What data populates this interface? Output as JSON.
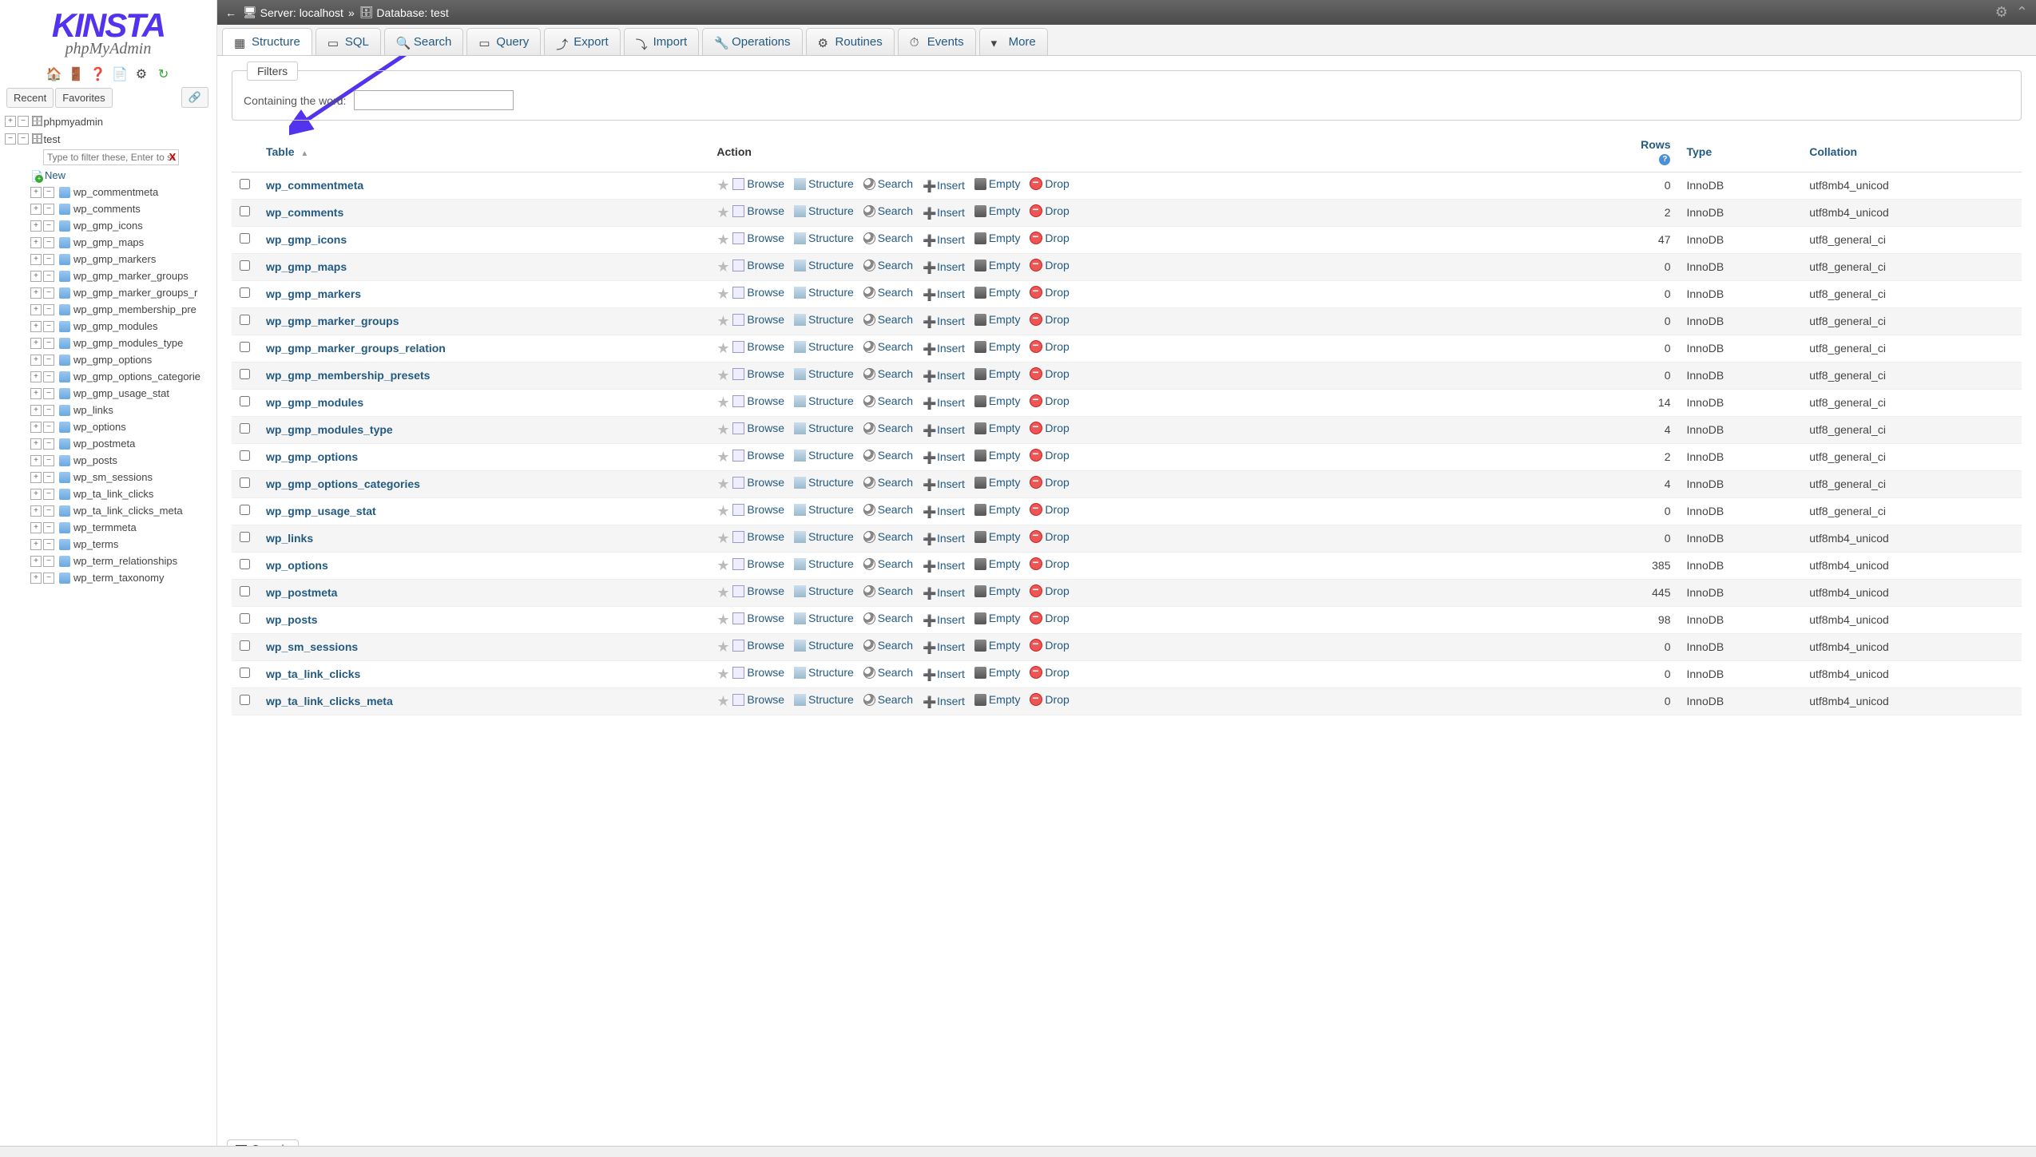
{
  "brand": {
    "name": "KINSTA",
    "subtitle": "phpMyAdmin"
  },
  "nav_icons": [
    "home-icon",
    "exit-icon",
    "help-icon",
    "sql-icon",
    "gear-icon",
    "reload-icon"
  ],
  "recent_fav": {
    "recent": "Recent",
    "favorites": "Favorites"
  },
  "tree": {
    "root": "phpmyadmin",
    "db": "test",
    "filter_placeholder": "Type to filter these, Enter to search",
    "new_label": "New",
    "tables": [
      "wp_commentmeta",
      "wp_comments",
      "wp_gmp_icons",
      "wp_gmp_maps",
      "wp_gmp_markers",
      "wp_gmp_marker_groups",
      "wp_gmp_marker_groups_r",
      "wp_gmp_membership_pre",
      "wp_gmp_modules",
      "wp_gmp_modules_type",
      "wp_gmp_options",
      "wp_gmp_options_categorie",
      "wp_gmp_usage_stat",
      "wp_links",
      "wp_options",
      "wp_postmeta",
      "wp_posts",
      "wp_sm_sessions",
      "wp_ta_link_clicks",
      "wp_ta_link_clicks_meta",
      "wp_termmeta",
      "wp_terms",
      "wp_term_relationships",
      "wp_term_taxonomy"
    ]
  },
  "breadcrumb": {
    "server_label": "Server:",
    "server": "localhost",
    "db_label": "Database:",
    "db": "test"
  },
  "tabs": [
    {
      "icon": "structure-icon",
      "label": "Structure",
      "active": true
    },
    {
      "icon": "sql-icon",
      "label": "SQL"
    },
    {
      "icon": "search-icon",
      "label": "Search"
    },
    {
      "icon": "query-icon",
      "label": "Query"
    },
    {
      "icon": "export-icon",
      "label": "Export"
    },
    {
      "icon": "import-icon",
      "label": "Import"
    },
    {
      "icon": "operations-icon",
      "label": "Operations"
    },
    {
      "icon": "routines-icon",
      "label": "Routines"
    },
    {
      "icon": "events-icon",
      "label": "Events"
    },
    {
      "icon": "more-icon",
      "label": "More"
    }
  ],
  "filters": {
    "legend": "Filters",
    "label": "Containing the word:",
    "value": ""
  },
  "columns": {
    "table": "Table",
    "action": "Action",
    "rows": "Rows",
    "type": "Type",
    "collation": "Collation"
  },
  "actions": {
    "browse": "Browse",
    "structure": "Structure",
    "search": "Search",
    "insert": "Insert",
    "empty": "Empty",
    "drop": "Drop"
  },
  "rows": [
    {
      "name": "wp_commentmeta",
      "rows": "0",
      "type": "InnoDB",
      "collation": "utf8mb4_unicod"
    },
    {
      "name": "wp_comments",
      "rows": "2",
      "type": "InnoDB",
      "collation": "utf8mb4_unicod"
    },
    {
      "name": "wp_gmp_icons",
      "rows": "47",
      "type": "InnoDB",
      "collation": "utf8_general_ci"
    },
    {
      "name": "wp_gmp_maps",
      "rows": "0",
      "type": "InnoDB",
      "collation": "utf8_general_ci"
    },
    {
      "name": "wp_gmp_markers",
      "rows": "0",
      "type": "InnoDB",
      "collation": "utf8_general_ci"
    },
    {
      "name": "wp_gmp_marker_groups",
      "rows": "0",
      "type": "InnoDB",
      "collation": "utf8_general_ci"
    },
    {
      "name": "wp_gmp_marker_groups_relation",
      "rows": "0",
      "type": "InnoDB",
      "collation": "utf8_general_ci"
    },
    {
      "name": "wp_gmp_membership_presets",
      "rows": "0",
      "type": "InnoDB",
      "collation": "utf8_general_ci"
    },
    {
      "name": "wp_gmp_modules",
      "rows": "14",
      "type": "InnoDB",
      "collation": "utf8_general_ci"
    },
    {
      "name": "wp_gmp_modules_type",
      "rows": "4",
      "type": "InnoDB",
      "collation": "utf8_general_ci"
    },
    {
      "name": "wp_gmp_options",
      "rows": "2",
      "type": "InnoDB",
      "collation": "utf8_general_ci"
    },
    {
      "name": "wp_gmp_options_categories",
      "rows": "4",
      "type": "InnoDB",
      "collation": "utf8_general_ci"
    },
    {
      "name": "wp_gmp_usage_stat",
      "rows": "0",
      "type": "InnoDB",
      "collation": "utf8_general_ci"
    },
    {
      "name": "wp_links",
      "rows": "0",
      "type": "InnoDB",
      "collation": "utf8mb4_unicod"
    },
    {
      "name": "wp_options",
      "rows": "385",
      "type": "InnoDB",
      "collation": "utf8mb4_unicod"
    },
    {
      "name": "wp_postmeta",
      "rows": "445",
      "type": "InnoDB",
      "collation": "utf8mb4_unicod"
    },
    {
      "name": "wp_posts",
      "rows": "98",
      "type": "InnoDB",
      "collation": "utf8mb4_unicod"
    },
    {
      "name": "wp_sm_sessions",
      "rows": "0",
      "type": "InnoDB",
      "collation": "utf8mb4_unicod"
    },
    {
      "name": "wp_ta_link_clicks",
      "rows": "0",
      "type": "InnoDB",
      "collation": "utf8mb4_unicod"
    },
    {
      "name": "wp_ta_link_clicks_meta",
      "rows": "0",
      "type": "InnoDB",
      "collation": "utf8mb4_unicod"
    }
  ],
  "console": {
    "label": "Console"
  }
}
